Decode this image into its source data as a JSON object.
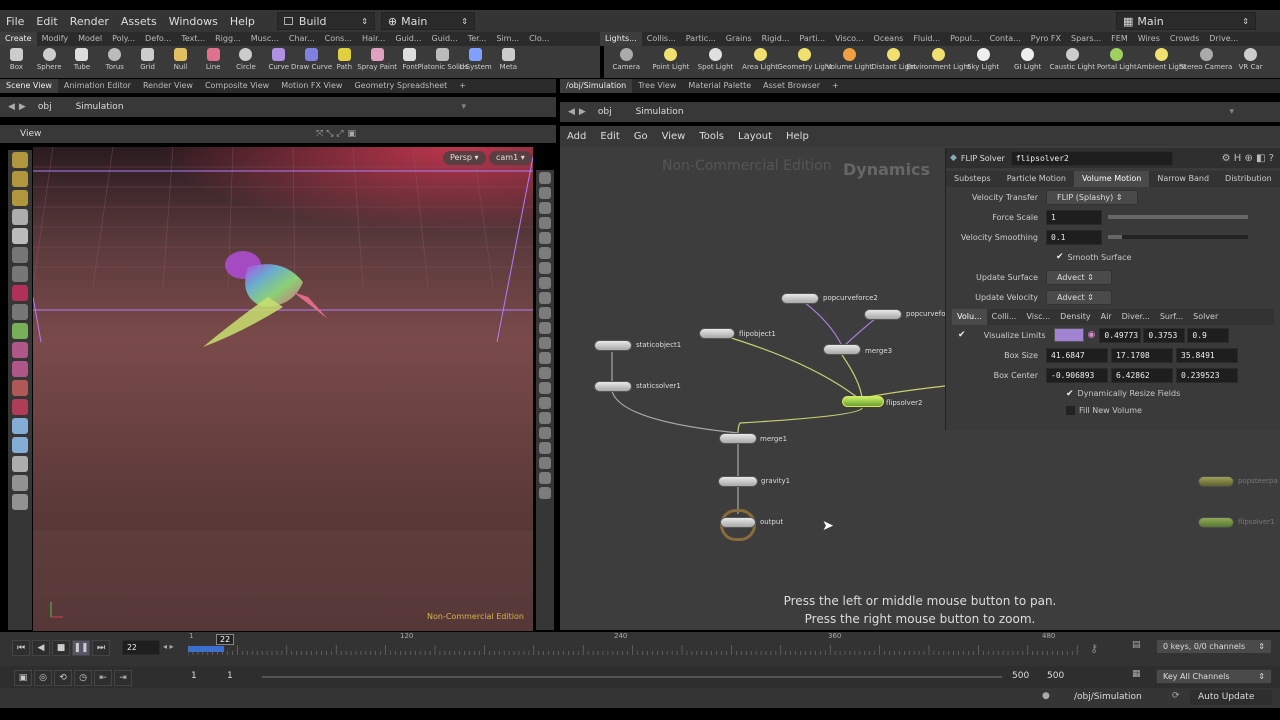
{
  "menu": {
    "items": [
      "File",
      "Edit",
      "Render",
      "Assets",
      "Windows",
      "Help"
    ],
    "desktop": "Build",
    "main_left": "Main",
    "main_right": "Main"
  },
  "shelf_tabs_left": [
    "Create",
    "Modify",
    "Model",
    "Poly...",
    "Defo...",
    "Text...",
    "Rigg...",
    "Musc...",
    "Char...",
    "Cons...",
    "Hair...",
    "Guid...",
    "Guid...",
    "Ter...",
    "Sim...",
    "Clo..."
  ],
  "shelf_tabs_right": [
    "Lights...",
    "Collis...",
    "Partic...",
    "Grains",
    "Rigid...",
    "Parti...",
    "Visco...",
    "Oceans",
    "Fluid...",
    "Popul...",
    "Conta...",
    "Pyro FX",
    "Spars...",
    "FEM",
    "Wires",
    "Crowds",
    "Drive..."
  ],
  "tools_left": [
    "Box",
    "Sphere",
    "Tube",
    "Torus",
    "Grid",
    "Null",
    "Line",
    "Circle",
    "Curve",
    "Draw Curve",
    "Path",
    "Spray Paint",
    "Font",
    "Platonic Solids",
    "L-System",
    "Meta"
  ],
  "tools_right": [
    "Camera",
    "Point Light",
    "Spot Light",
    "Area Light",
    "Geometry Light",
    "Volume Light",
    "Distant Light",
    "Environment Light",
    "Sky Light",
    "GI Light",
    "Caustic Light",
    "Portal Light",
    "Ambient Light",
    "Stereo Camera",
    "VR Car"
  ],
  "left_panes": [
    "Scene View",
    "Animation Editor",
    "Render View",
    "Composite View",
    "Motion FX View",
    "Geometry Spreadsheet"
  ],
  "right_panes": [
    "/obj/Simulation",
    "Tree View",
    "Material Palette",
    "Asset Browser"
  ],
  "left_path": {
    "obj": "obj",
    "sim": "Simulation"
  },
  "right_path": {
    "obj": "obj",
    "sim": "Simulation"
  },
  "viewport": {
    "title": "View",
    "persp": "Persp",
    "cam": "cam1",
    "watermark": "Non-Commercial Edition"
  },
  "network": {
    "menus": [
      "Add",
      "Edit",
      "Go",
      "View",
      "Tools",
      "Layout",
      "Help"
    ],
    "watermark": "Non-Commercial Edition",
    "context": "Dynamics",
    "hint1": "Press the left or middle mouse button to pan.",
    "hint2": "Press the right mouse button to zoom.",
    "nodes": {
      "popcurveforce2": "popcurveforce2",
      "popcurvefo": "popcurvefo",
      "flipobject1": "flipobject1",
      "merge3": "merge3",
      "staticobject1": "staticobject1",
      "staticsolver1": "staticsolver1",
      "flipsolver2": "flipsolver2",
      "merge1": "merge1",
      "gravity1": "gravity1",
      "output": "output",
      "popsteerpa": "popsteerpa",
      "flipsolver1": "flipsolver1"
    }
  },
  "params": {
    "type": "FLIP Solver",
    "name": "flipsolver2",
    "tabs": [
      "Substeps",
      "Particle Motion",
      "Volume Motion",
      "Narrow Band",
      "Distribution"
    ],
    "velocity_transfer_label": "Velocity Transfer",
    "velocity_transfer": "FLIP (Splashy)",
    "force_scale_label": "Force Scale",
    "force_scale": "1",
    "force_scale_fill": 1.0,
    "velocity_smoothing_label": "Velocity Smoothing",
    "velocity_smoothing": "0.1",
    "velocity_smoothing_fill": 0.1,
    "smooth_surface": "Smooth Surface",
    "update_surface_label": "Update Surface",
    "update_surface": "Advect",
    "update_velocity_label": "Update Velocity",
    "update_velocity": "Advect",
    "subtabs": [
      "Volu...",
      "Colli...",
      "Visc...",
      "Density",
      "Air",
      "Diver...",
      "Surf...",
      "Solver"
    ],
    "visualize_limits_label": "Visualize Limits",
    "visualize_color": [
      "0.49773",
      "0.3753",
      "0.9"
    ],
    "box_size_label": "Box Size",
    "box_size": [
      "41.6847",
      "17.1708",
      "35.8491"
    ],
    "box_center_label": "Box Center",
    "box_center": [
      "-0.906893",
      "6.42862",
      "0.239523"
    ],
    "dyn_resize": "Dynamically Resize Fields",
    "fill_new": "Fill New Volume"
  },
  "timeline": {
    "frame": "22",
    "marker": "22",
    "ticks": [
      "1",
      "120",
      "240",
      "360",
      "480"
    ],
    "start": "1",
    "start2": "1",
    "end": "500",
    "end2": "500",
    "keys": "0 keys, 0/0 channels",
    "key_all": "Key All Channels"
  },
  "status": {
    "path": "/obj/Simulation",
    "update": "Auto Update"
  }
}
